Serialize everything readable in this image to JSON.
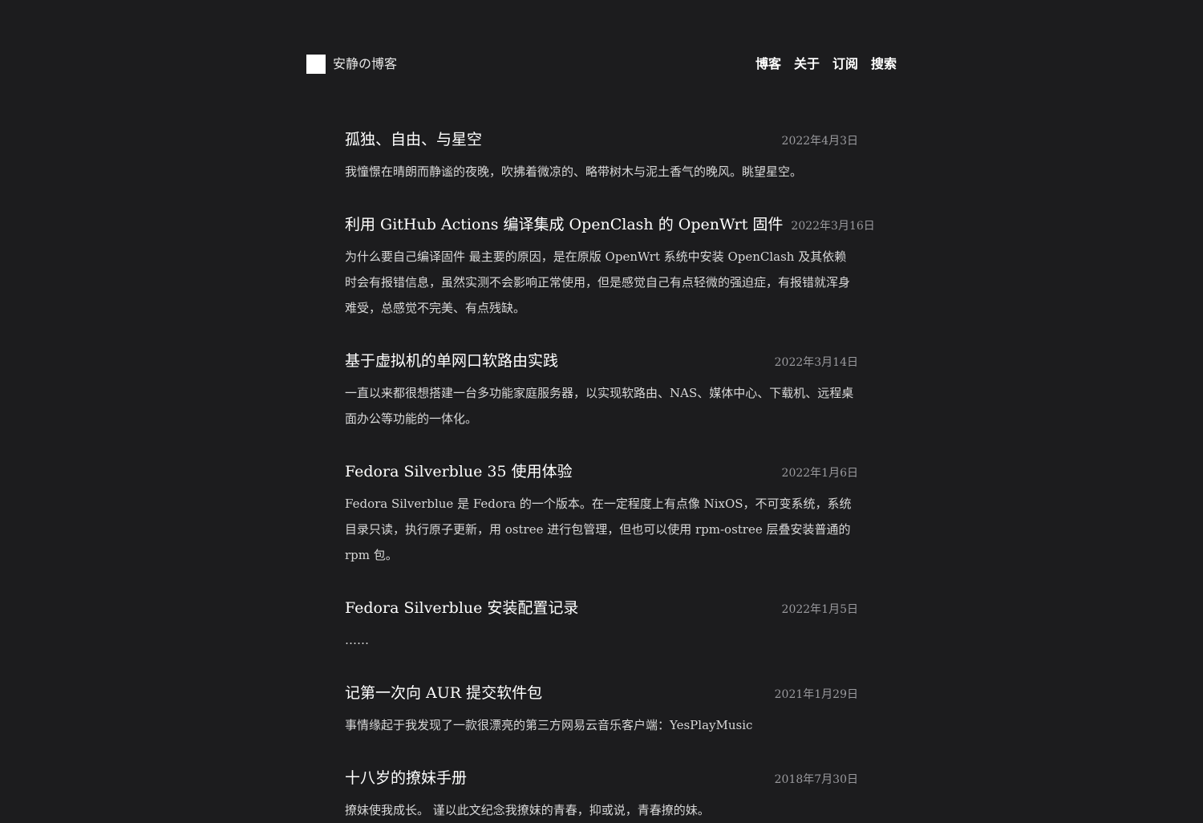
{
  "header": {
    "site_title": "安静の博客",
    "nav": [
      {
        "label": "博客"
      },
      {
        "label": "关于"
      },
      {
        "label": "订阅"
      },
      {
        "label": "搜索"
      }
    ]
  },
  "posts": [
    {
      "title": "孤独、自由、与星空",
      "date": "2022年4月3日",
      "summary": "我憧憬在晴朗而静谧的夜晚，吹拂着微凉的、略带树木与泥土香气的晚风。眺望星空。"
    },
    {
      "title": "利用 GitHub Actions 编译集成 OpenClash 的 OpenWrt 固件",
      "date": "2022年3月16日",
      "summary": "为什么要自己编译固件 最主要的原因，是在原版 OpenWrt 系统中安装 OpenClash 及其依赖时会有报错信息，虽然实测不会影响正常使用，但是感觉自己有点轻微的强迫症，有报错就浑身难受，总感觉不完美、有点残缺。"
    },
    {
      "title": "基于虚拟机的单网口软路由实践",
      "date": "2022年3月14日",
      "summary": "一直以来都很想搭建一台多功能家庭服务器，以实现软路由、NAS、媒体中心、下载机、远程桌面办公等功能的一体化。"
    },
    {
      "title": "Fedora Silverblue 35 使用体验",
      "date": "2022年1月6日",
      "summary": "Fedora Silverblue 是 Fedora 的一个版本。在一定程度上有点像 NixOS，不可变系统，系统目录只读，执行原子更新，用 ostree 进行包管理，但也可以使用 rpm-ostree 层叠安装普通的 rpm 包。"
    },
    {
      "title": "Fedora Silverblue 安装配置记录",
      "date": "2022年1月5日",
      "summary": "……"
    },
    {
      "title": "记第一次向 AUR 提交软件包",
      "date": "2021年1月29日",
      "summary": "事情缘起于我发现了一款很漂亮的第三方网易云音乐客户端：YesPlayMusic"
    },
    {
      "title": "十八岁的撩妹手册",
      "date": "2018年7月30日",
      "summary": "撩妹使我成长。 谨以此文纪念我撩妹的青春，抑或说，青春撩的妹。"
    }
  ]
}
